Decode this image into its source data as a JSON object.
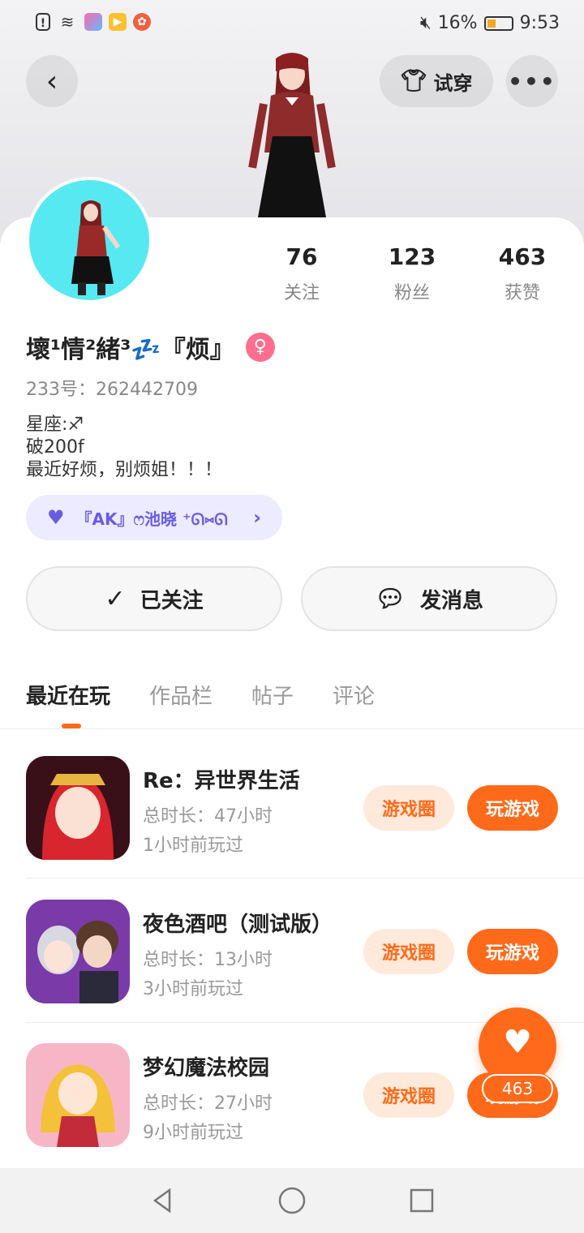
{
  "status_bar": {
    "battery": "16%",
    "time": "9:53"
  },
  "header": {
    "try_on_label": "试穿",
    "more_label": "•••"
  },
  "profile": {
    "nickname": "壞¹情²緒³💤『烦』",
    "uid": "233号：262442709",
    "bio_lines": [
      "星座:♐",
      "破200f",
      "最近好烦，别烦姐！！！"
    ],
    "club_name": "『AK』ෆ池晓  ⁺ᘏ⑅ᘏ",
    "gender_symbol": "♀",
    "stats": [
      {
        "value": "76",
        "label": "关注"
      },
      {
        "value": "123",
        "label": "粉丝"
      },
      {
        "value": "463",
        "label": "获赞"
      }
    ]
  },
  "actions": {
    "follow_label": "已关注",
    "message_label": "发消息"
  },
  "tabs": [
    "最近在玩",
    "作品栏",
    "帖子",
    "评论"
  ],
  "games": [
    {
      "title": "Re：异世界生活",
      "duration": "总时长：47小时",
      "last_played": "1小时前玩过",
      "circle_label": "游戏圈",
      "play_label": "玩游戏"
    },
    {
      "title": "夜色酒吧（测试版）",
      "duration": "总时长：13小时",
      "last_played": "3小时前玩过",
      "circle_label": "游戏圈",
      "play_label": "玩游戏"
    },
    {
      "title": "梦幻魔法校园",
      "duration": "总时长：27小时",
      "last_played": "9小时前玩过",
      "circle_label": "游戏圈",
      "play_label": "玩游戏"
    }
  ],
  "floating_like": {
    "count": "463"
  },
  "colors": {
    "accent": "#ff6a1a",
    "club_bg": "#ecebff",
    "club_text": "#6a5ce0"
  }
}
